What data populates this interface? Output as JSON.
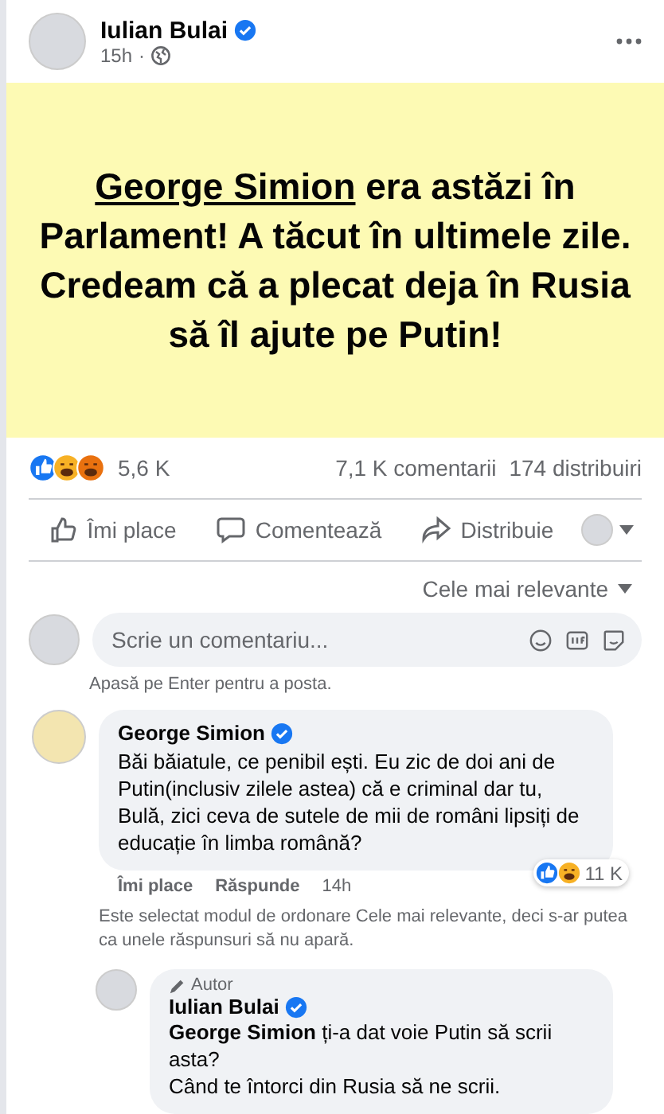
{
  "post": {
    "author": "Iulian Bulai",
    "verified": true,
    "time": "15h",
    "separator": "·",
    "headline": [
      {
        "text": "George Simion",
        "underlined": true
      },
      {
        "text": " era astăzi în Parlament! A tăcut în ultimele zile.",
        "underlined": false
      }
    ],
    "headline_2": "Credeam că a plecat deja în Rusia să îl ajute pe Putin!",
    "reaction_count": "5,6 K",
    "comments_count": "7,1 K comentarii",
    "shares_count": "174 distribuiri",
    "actions": [
      {
        "kind": "like",
        "label": "Îmi place"
      },
      {
        "kind": "comment",
        "label": "Comentează"
      },
      {
        "kind": "share",
        "label": "Distribuie"
      }
    ]
  },
  "sort": {
    "label": "Cele mai relevante"
  },
  "composer": {
    "placeholder": "Scrie un comentariu...",
    "hint": "Apasă pe Enter pentru a posta."
  },
  "comment": {
    "author": "George Simion",
    "verified": true,
    "text": "Băi băiatule, ce penibil ești. Eu zic de doi ani de Putin(inclusiv zilele astea) că e criminal dar tu, Bulă, zici ceva de sutele de mii de români lipsiți de educație în limba română?",
    "like": "Îmi place",
    "reply": "Răspunde",
    "time": "14h",
    "reaction_count": "11 K"
  },
  "notice": "Este selectat modul de ordonare Cele mai relevante, deci s-ar putea ca unele răspunsuri să nu apară.",
  "reply": {
    "badge": "Autor",
    "author": "Iulian Bulai",
    "verified": true,
    "text": "**George Simion** ți-a dat voie Putin să scrii asta?\nCând te întorci din Rusia să ne scrii."
  }
}
